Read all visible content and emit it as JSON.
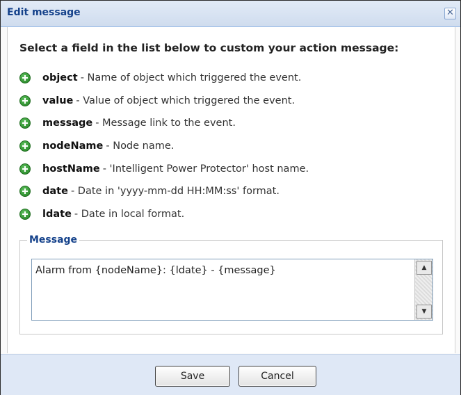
{
  "dialog": {
    "title": "Edit message",
    "close_glyph": "✕",
    "intro": "Select a field in the list below to custom your action message:",
    "fields": [
      {
        "name": "object",
        "desc": "- Name of object which triggered the event.",
        "icon": "plus-circle-icon"
      },
      {
        "name": "value",
        "desc": "- Value of object which triggered the event.",
        "icon": "plus-circle-icon"
      },
      {
        "name": "message",
        "desc": "- Message link to the event.",
        "icon": "plus-circle-icon"
      },
      {
        "name": "nodeName",
        "desc": "- Node name.",
        "icon": "plus-circle-icon"
      },
      {
        "name": "hostName",
        "desc": "- 'Intelligent Power Protector' host name.",
        "icon": "plus-circle-icon"
      },
      {
        "name": "date",
        "desc": "- Date in 'yyyy-mm-dd HH:MM:ss' format.",
        "icon": "plus-circle-icon"
      },
      {
        "name": "ldate",
        "desc": "- Date in local format.",
        "icon": "plus-circle-icon"
      }
    ],
    "message_legend": "Message",
    "message_value": "Alarm from {nodeName}: {ldate} - {message}",
    "save_label": "Save",
    "cancel_label": "Cancel"
  },
  "colors": {
    "title": "#15428b",
    "footer": "#dfe8f6",
    "icon_green": "#2e9b2e"
  }
}
